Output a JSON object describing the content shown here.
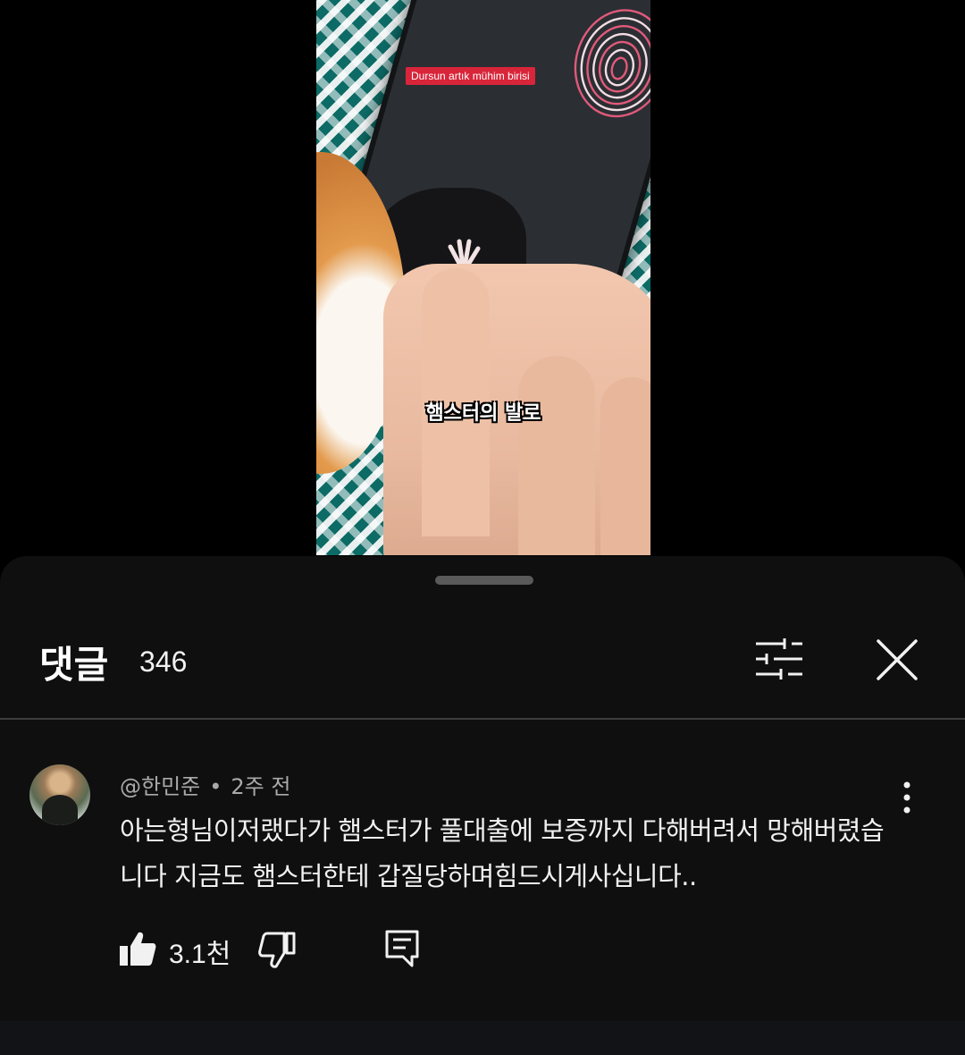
{
  "video": {
    "tag_text": "Dursun artık mühim birisi",
    "caption": "햄스터의 발로"
  },
  "sheet": {
    "title": "댓글",
    "count": "346"
  },
  "comment": {
    "author": "@한민준",
    "separator": "•",
    "time": "2주 전",
    "text": "아는형님이저랬다가 햄스터가 풀대출에 보증까지 다해버려서 망해버렸습니다 지금도 햄스터한테 갑질당하며힘드시게사십니다..",
    "like_count": "3.1천"
  },
  "icons": {
    "filter": "filter-sliders-icon",
    "close": "close-icon",
    "more": "more-vertical-icon",
    "like": "thumbs-up-icon",
    "dislike": "thumbs-down-icon",
    "reply": "reply-comment-icon"
  },
  "colors": {
    "sheet_background": "#0f0f0f",
    "text_primary": "#f1f1f1",
    "text_secondary": "#aaaaaa",
    "video_tag": "#d8253a"
  }
}
